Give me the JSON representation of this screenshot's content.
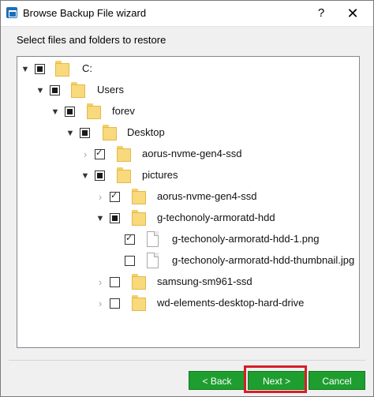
{
  "window": {
    "title": "Browse Backup File wizard",
    "help": "?",
    "close": "✕"
  },
  "instruction": "Select files and folders to restore",
  "tree": [
    {
      "label": "C:",
      "state": "partial",
      "expanded": true,
      "type": "folder"
    },
    {
      "label": "Users",
      "state": "partial",
      "expanded": true,
      "type": "folder"
    },
    {
      "label": "forev",
      "state": "partial",
      "expanded": true,
      "type": "folder"
    },
    {
      "label": "Desktop",
      "state": "partial",
      "expanded": true,
      "type": "folder"
    },
    {
      "label": "aorus-nvme-gen4-ssd",
      "state": "checked",
      "expanded": false,
      "type": "folder"
    },
    {
      "label": "pictures",
      "state": "partial",
      "expanded": true,
      "type": "folder"
    },
    {
      "label": "aorus-nvme-gen4-ssd",
      "state": "checked",
      "expanded": false,
      "type": "folder"
    },
    {
      "label": "g-techonoly-armoratd-hdd",
      "state": "partial",
      "expanded": true,
      "type": "folder"
    },
    {
      "label": "g-techonoly-armoratd-hdd-1.png",
      "state": "checked",
      "type": "file"
    },
    {
      "label": "g-techonoly-armoratd-hdd-thumbnail.jpg",
      "state": "unchecked",
      "type": "file"
    },
    {
      "label": "samsung-sm961-ssd",
      "state": "unchecked",
      "expanded": false,
      "type": "folder"
    },
    {
      "label": "wd-elements-desktop-hard-drive",
      "state": "unchecked",
      "expanded": false,
      "type": "folder"
    }
  ],
  "buttons": {
    "back": "< Back",
    "next": "Next >",
    "cancel": "Cancel"
  },
  "colors": {
    "button_green": "#1e9e2f",
    "highlight_red": "#d61f26",
    "folder_yellow": "#f8d97c"
  }
}
